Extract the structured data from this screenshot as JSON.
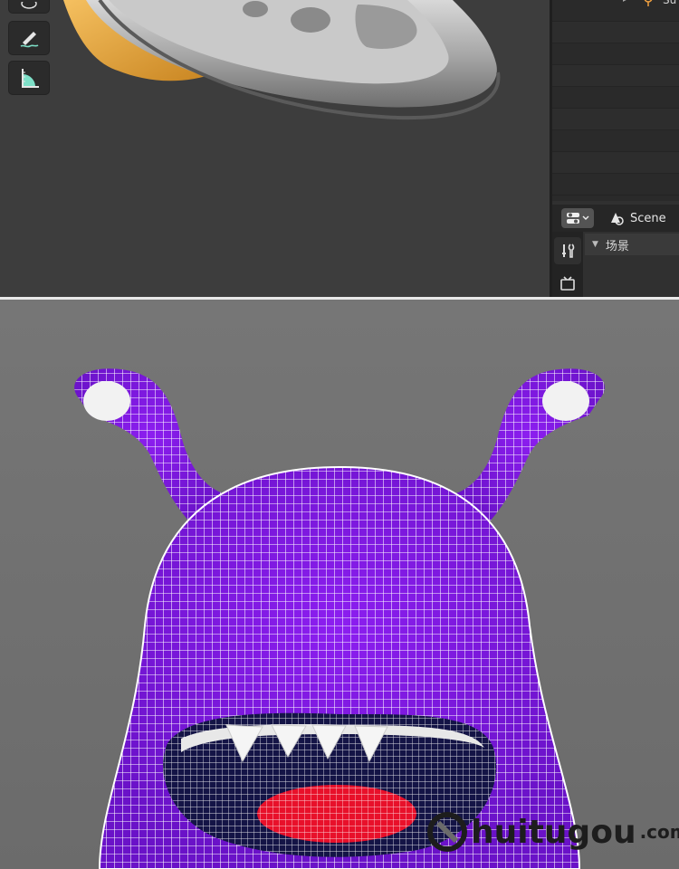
{
  "toolbar": {
    "tools": [
      {
        "icon": "view-icon"
      },
      {
        "icon": "annotate-pen-icon"
      },
      {
        "icon": "measure-ruler-icon"
      }
    ]
  },
  "outliner": {
    "items": [
      {
        "label": "Su",
        "icon": "light-icon"
      }
    ]
  },
  "properties": {
    "scene_label": "Scene",
    "panel_title": "场景",
    "tabs": [
      {
        "icon": "tool-icon"
      },
      {
        "icon": "render-icon"
      }
    ]
  },
  "watermark": {
    "brand": "huitugou",
    "suffix": ".com"
  },
  "colors": {
    "monster_body": "#8c1ef0",
    "mouth_dark": "#141446",
    "tongue": "#e8102a",
    "ufo_metal": "#b9b9b9",
    "ufo_flame": "#e8a838"
  }
}
